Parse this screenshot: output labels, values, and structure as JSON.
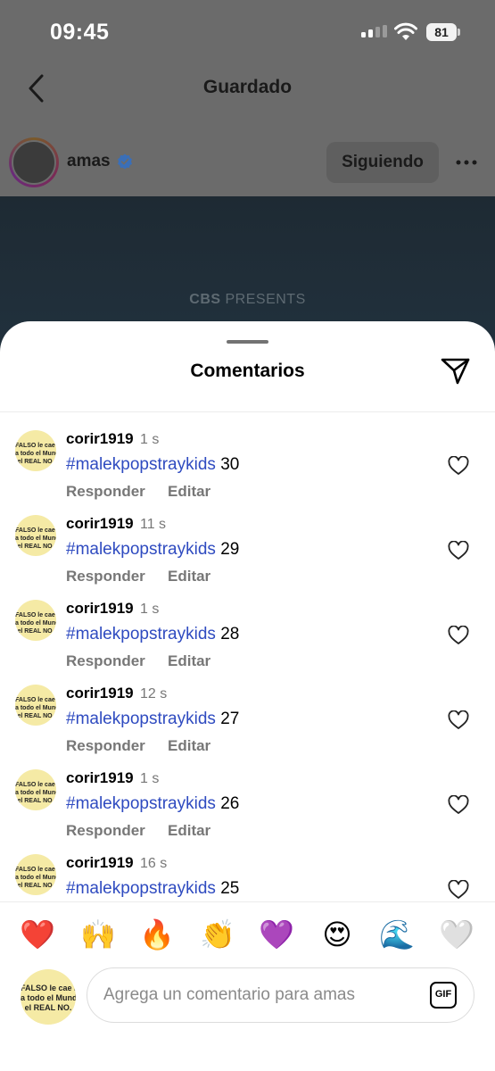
{
  "status_bar": {
    "time": "09:45",
    "battery": "81"
  },
  "nav": {
    "title": "Guardado"
  },
  "post": {
    "username": "amas",
    "follow_label": "Siguiendo",
    "media_caption_bold": "CBS",
    "media_caption_rest": " PRESENTS"
  },
  "comments_sheet": {
    "title": "Comentarios",
    "reply_label": "Responder",
    "edit_label": "Editar",
    "avatar_text": [
      "FALSO le cae Bi",
      "a todo el Mundo",
      "el REAL NO."
    ],
    "comments": [
      {
        "user": "corir1919",
        "time": "1 s",
        "hashtag": "#malekpopstraykids",
        "number": "30"
      },
      {
        "user": "corir1919",
        "time": "11 s",
        "hashtag": "#malekpopstraykids",
        "number": "29"
      },
      {
        "user": "corir1919",
        "time": "1 s",
        "hashtag": "#malekpopstraykids",
        "number": "28"
      },
      {
        "user": "corir1919",
        "time": "12 s",
        "hashtag": "#malekpopstraykids",
        "number": "27"
      },
      {
        "user": "corir1919",
        "time": "1 s",
        "hashtag": "#malekpopstraykids",
        "number": "26"
      },
      {
        "user": "corir1919",
        "time": "16 s",
        "hashtag": "#malekpopstraykids",
        "number": "25"
      }
    ]
  },
  "emoji_bar": {
    "emojis": [
      "❤️",
      "🙌",
      "🔥",
      "👏",
      "💜",
      "😍",
      "🌊",
      "🤍"
    ]
  },
  "composer": {
    "placeholder": "Agrega un comentario para amas",
    "gif_label": "GIF"
  },
  "colors": {
    "hashtag": "#2f4bc0",
    "verified": "#3a6fb8",
    "sheet": "#ffffff"
  }
}
